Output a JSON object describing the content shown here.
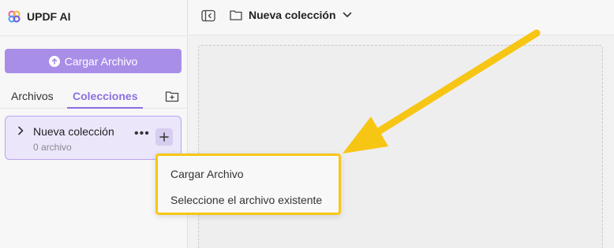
{
  "app": {
    "brand_name": "UPDF AI"
  },
  "sidebar": {
    "upload_label": "Cargar Archivo",
    "tabs": [
      {
        "label": "Archivos",
        "active": false
      },
      {
        "label": "Colecciones",
        "active": true
      }
    ],
    "collections": [
      {
        "name": "Nueva colección",
        "count": "0 archivo",
        "expanded": false
      }
    ]
  },
  "topbar": {
    "collection_name": "Nueva colección"
  },
  "menu": {
    "items": [
      {
        "label": "Cargar Archivo"
      },
      {
        "label": "Seleccione el archivo existente"
      }
    ]
  },
  "icons": {
    "logo": "updf-logo-icon",
    "upload": "upload-icon",
    "new_folder": "new-folder-icon",
    "chevron": "chevron-right-icon",
    "more": "more-icon",
    "add": "plus-icon",
    "panel_toggle": "panel-toggle-icon",
    "folder": "folder-icon",
    "dropdown": "chevron-down-icon"
  },
  "colors": {
    "accent": "#8c6fe0",
    "upload_button": "#a98ee8",
    "highlight": "#f7c614",
    "selected_item_bg": "#ece6fb"
  }
}
